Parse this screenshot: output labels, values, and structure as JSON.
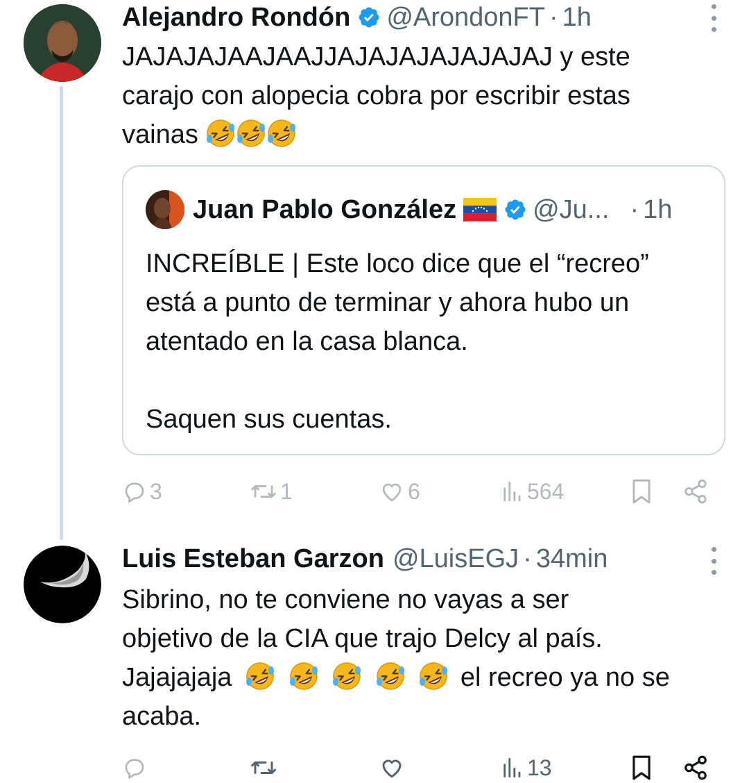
{
  "tweets": [
    {
      "name": "Alejandro Rondón",
      "handle": "@ArondonFT",
      "separator": "·",
      "time": "1h",
      "text_lines": [
        "JAJAJAJAAJAAJJAJAJAJAJAJAJAJ y este",
        "carajo con alopecia cobra por escribir estas",
        "vainas"
      ],
      "emojis": [
        "rolling-on-floor-laughing",
        "rolling-on-floor-laughing",
        "rolling-on-floor-laughing"
      ],
      "quote": {
        "name": "Juan Pablo González",
        "handle": "@Ju...",
        "separator": "·",
        "time": "1h",
        "flag": "venezuela-flag",
        "text_lines": [
          "INCREÍBLE | Este loco dice que el “recreo”",
          "está a punto de terminar y ahora hubo un",
          "atentado en la casa blanca.",
          "",
          "Saquen sus cuentas."
        ]
      },
      "actions": {
        "replies": "3",
        "reposts": "1",
        "likes": "6",
        "views": "564"
      }
    },
    {
      "name": "Luis Esteban Garzon",
      "handle": "@LuisEGJ",
      "separator": "·",
      "time": "34min",
      "text_lines": [
        "Sibrino, no te conviene no vayas a ser",
        "objetivo de la CIA que trajo Delcy al país.",
        "Jajajajaja",
        "el recreo ya no se",
        "acaba."
      ],
      "emojis": [
        "rolling-on-floor-laughing",
        "rolling-on-floor-laughing",
        "rolling-on-floor-laughing",
        "rolling-on-floor-laughing",
        "rolling-on-floor-laughing"
      ],
      "actions": {
        "replies": "",
        "reposts": "",
        "likes": "",
        "views": "13"
      }
    }
  ],
  "colors": {
    "text": "#0f1419",
    "secondary": "#536471",
    "verified": "#1d9bf0",
    "border": "#cfd9de",
    "emoji": "#f5b81c"
  }
}
